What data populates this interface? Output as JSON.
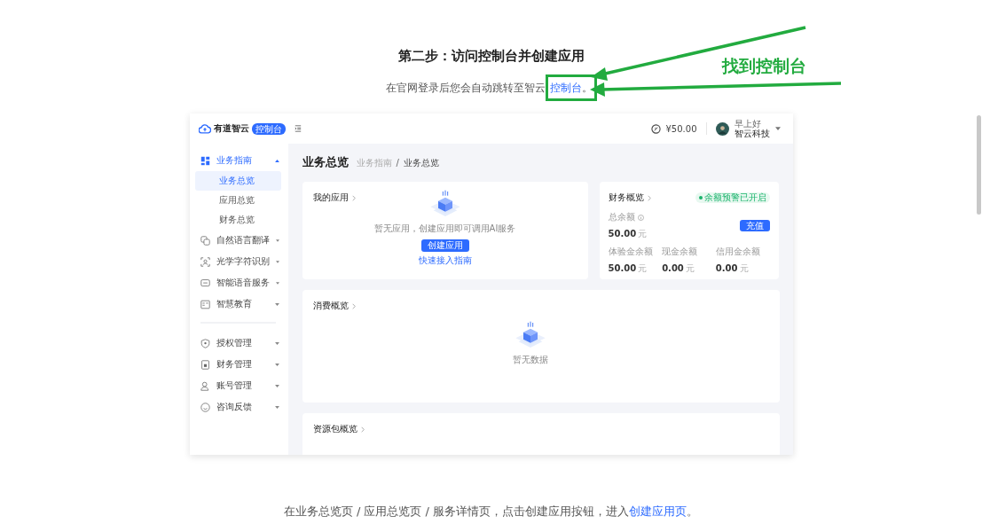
{
  "doc": {
    "title": "第二步：访问控制台并创建应用",
    "intro": "在官网登录后您会自动跳转至智云",
    "intro_link": "控制台",
    "intro_end": "。",
    "annotation": "找到控制台",
    "footer": "在业务总览页 / 应用总览页 / 服务详情页，点击创建应用按钮，进入",
    "footer_link": "创建应用页",
    "footer_end": "。"
  },
  "app": {
    "header": {
      "brand": "有道智云",
      "badge": "控制台",
      "balance": "¥50.00",
      "greeting": "早上好",
      "user": "智云科技"
    },
    "sidebar": {
      "groups": [
        [
          {
            "label": "业务指南",
            "expanded": true,
            "children": [
              {
                "label": "业务总览",
                "selected": true
              },
              {
                "label": "应用总览",
                "selected": false
              },
              {
                "label": "财务总览",
                "selected": false
              }
            ]
          },
          {
            "label": "自然语言翻译",
            "expanded": false
          },
          {
            "label": "光学字符识别",
            "expanded": false
          },
          {
            "label": "智能语音服务",
            "expanded": false
          },
          {
            "label": "智慧教育",
            "expanded": false
          }
        ],
        [
          {
            "label": "授权管理",
            "expanded": false
          },
          {
            "label": "财务管理",
            "expanded": false
          },
          {
            "label": "账号管理",
            "expanded": false
          },
          {
            "label": "咨询反馈",
            "expanded": false
          }
        ]
      ]
    },
    "page_title": "业务总览",
    "breadcrumb": [
      "业务指南",
      "业务总览"
    ],
    "breadcrumb_separator": "/",
    "my_apps": {
      "title": "我的应用",
      "empty_text": "暂无应用，创建应用即可调用AI服务",
      "create_button": "创建应用",
      "guide_link": "快速接入指南"
    },
    "finance": {
      "title": "财务概览",
      "badge": "余额预警已开启",
      "total_label": "总余额",
      "total": "50.00",
      "total_unit": "元",
      "recharge_button": "充值",
      "balances": [
        {
          "label": "体验金余额",
          "value": "50.00",
          "unit": "元"
        },
        {
          "label": "现金余额",
          "value": "0.00",
          "unit": "元"
        },
        {
          "label": "信用金余额",
          "value": "0.00",
          "unit": "元"
        }
      ]
    },
    "consumption": {
      "title": "消费概览",
      "empty_text": "暂无数据"
    },
    "packages": {
      "title": "资源包概览"
    }
  }
}
